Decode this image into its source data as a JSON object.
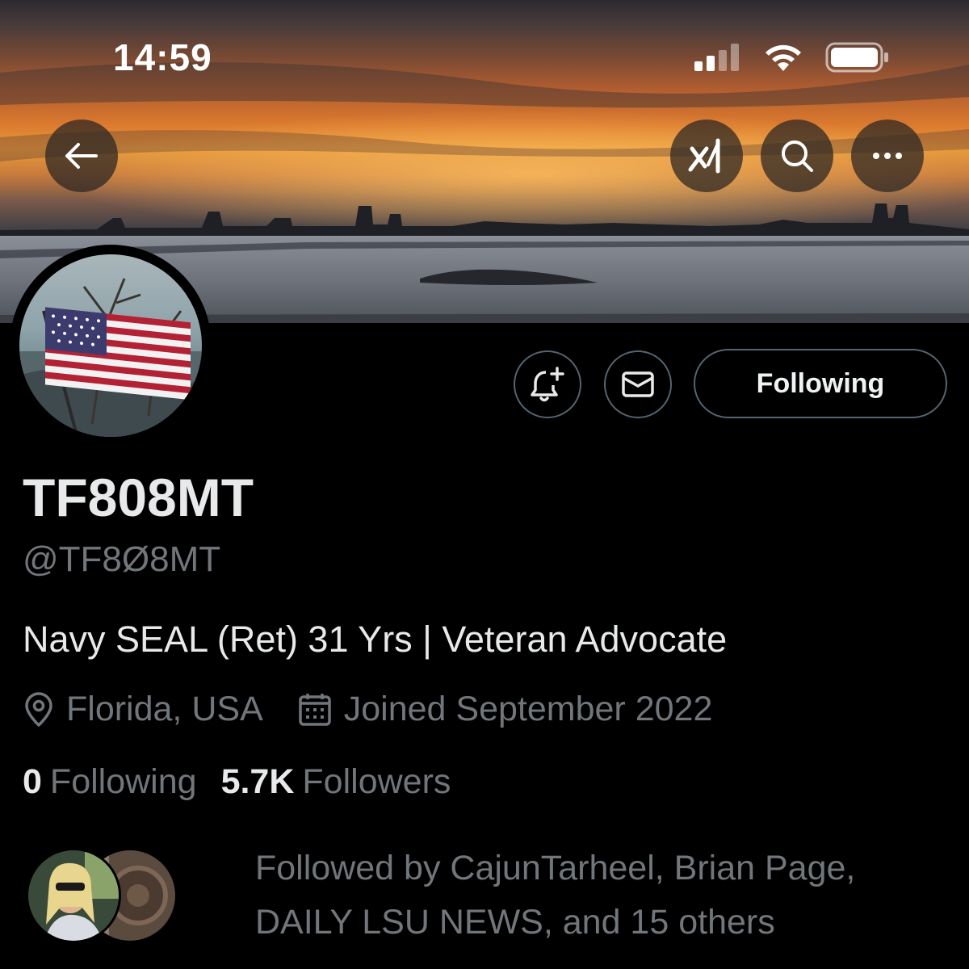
{
  "status_bar": {
    "time": "14:59",
    "icons": [
      "signal-icon",
      "wifi-icon",
      "battery-icon"
    ]
  },
  "nav": {
    "back_icon": "arrow-left-icon",
    "grok_icon": "grok-icon",
    "search_icon": "search-icon",
    "more_icon": "more-icon"
  },
  "profile": {
    "display_name": "TF808MT",
    "handle": "@TF8Ø8MT",
    "bio": "Navy SEAL (Ret) 31 Yrs | Veteran Advocate",
    "location": "Florida, USA",
    "joined": "Joined September 2022",
    "following_count": "0",
    "following_label": "Following",
    "followers_count": "5.7K",
    "followers_label": "Followers"
  },
  "actions": {
    "notify_icon": "bell-plus-icon",
    "message_icon": "envelope-icon",
    "follow_button_label": "Following"
  },
  "followed_by": {
    "line1": "Followed by CajunTarheel, Brian Page,",
    "line2": "DAILY LSU NEWS, and 15 others"
  },
  "colors": {
    "background": "#000000",
    "text_primary": "#e7e9ea",
    "text_secondary": "#71767b",
    "border": "#536471"
  }
}
